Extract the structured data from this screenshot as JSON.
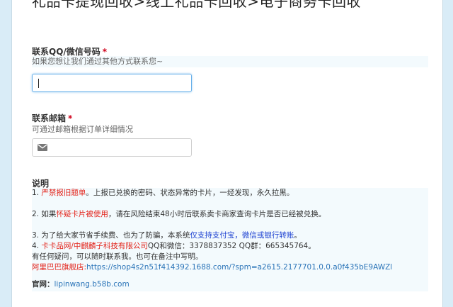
{
  "page": {
    "heading": "礼品卡提现回收>线上礼品卡回收>电子商务卡回收"
  },
  "contact_qq": {
    "label": "联系QQ/微信号码",
    "required_mark": "*",
    "hint": "如果您想让我们通过其他方式联系您~",
    "value": ""
  },
  "contact_email": {
    "label": "联系邮箱",
    "required_mark": "*",
    "hint": "可通过邮箱根据订单详细情况",
    "value": "",
    "icon": "envelope-icon"
  },
  "notes": {
    "title": "说明",
    "line1_prefix": "1. ",
    "line1_red": "严禁报旧题单",
    "line1_rest": "。上报已兑换的密码、状态异常的卡片，一经发现，永久拉黑。",
    "line2_prefix": "2. 如果",
    "line2_red": "怀疑卡片被使用",
    "line2_rest": "，请在风险结束48小时后联系卖卡商家查询卡片是否已经被兑换。",
    "line3_prefix": "3. 为了给大家节省手续费、也为了防骗，本系统",
    "line3_blue": "仅支持支付宝，微信或银行转账",
    "line3_end": "。",
    "line4_prefix": "4. ",
    "line4_red": "卡卡品网/中麒麟子科技有限公司",
    "line4_rest": "QQ和微信：3378837352 QQ群：665345764。",
    "line5": "有任何疑问，可以随时联系我。也可在备注中写明。",
    "line6_red": "阿里巴巴旗舰店:",
    "line6_link": "https://shop4s2n51f414392.1688.com/?spm=a2615.2177701.0.0.a0f435bE9AWZl",
    "official_label": "官网：",
    "official_link": "lipinwang.b58b.com"
  },
  "colors": {
    "accent_red": "#e3241b",
    "accent_blue": "#1a3fd1",
    "link_blue": "#2b74b8",
    "focus_border": "#66afe9"
  }
}
